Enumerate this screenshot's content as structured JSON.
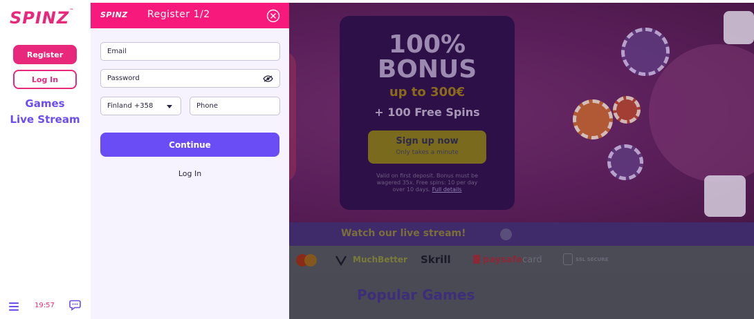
{
  "sidebar": {
    "logo": "SPINZ",
    "logo_tm": "™",
    "register_label": "Register",
    "login_label": "Log In",
    "nav": {
      "games": "Games",
      "live_stream": "Live Stream"
    },
    "time": "19:57"
  },
  "panel": {
    "logo": "SPINZ",
    "title": "Register 1/2",
    "email_placeholder": "Email",
    "password_placeholder": "Password",
    "country_value": "Finland +358",
    "phone_placeholder": "Phone",
    "continue_label": "Continue",
    "login_link": "Log In"
  },
  "background": {
    "promo": {
      "percent": "100%",
      "bonus": "BONUS",
      "up_to": "up to 300€",
      "free_spins": "+ 100 Free Spins",
      "signup_title": "Sign up now",
      "signup_sub": "Only takes a minute",
      "terms": "Valid on first deposit. Bonus must be wagered 35x. Free spins: 10 per day over 10 days.",
      "terms_link": "Full details"
    },
    "live_stream_text": "Watch our live stream!",
    "payments": {
      "much_better": "MuchBetter",
      "skrill": "Skrill",
      "paysafe": "paysafe",
      "paysafe_card": "card",
      "ssl": "SSL SECURE"
    },
    "popular_games": "Popular Games"
  },
  "colors": {
    "brand_pink": "#f7197b",
    "accent_purple": "#6a4df4",
    "sidebar_link": "#6c4cf0"
  }
}
